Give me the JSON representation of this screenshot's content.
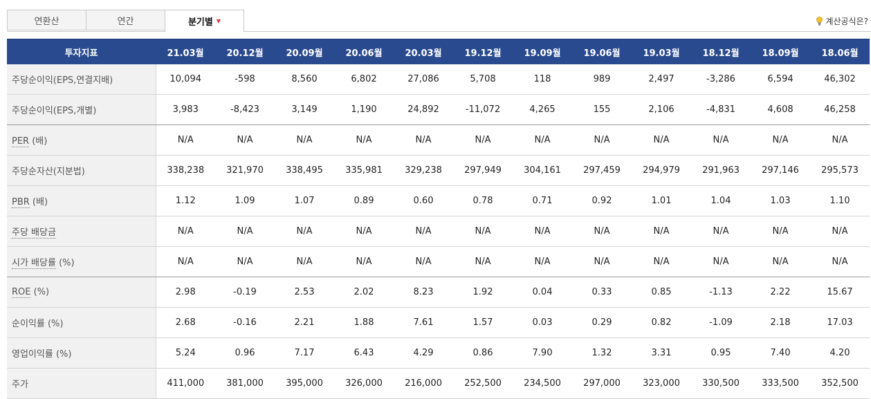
{
  "tabs": [
    {
      "label": "연환산"
    },
    {
      "label": "연간"
    },
    {
      "label": "분기별"
    }
  ],
  "help_link": "계산공식은?",
  "table": {
    "header_label": "투자지표",
    "periods": [
      "21.03월",
      "20.12월",
      "20.09월",
      "20.06월",
      "20.03월",
      "19.12월",
      "19.09월",
      "19.06월",
      "19.03월",
      "18.12월",
      "18.09월",
      "18.06월"
    ],
    "rows": [
      {
        "label": "주당순이익(EPS,연결지배)",
        "values": [
          "10,094",
          "-598",
          "8,560",
          "6,802",
          "27,086",
          "5,708",
          "118",
          "989",
          "2,497",
          "-3,286",
          "6,594",
          "46,302"
        ]
      },
      {
        "label": "주당순이익(EPS,개별)",
        "values": [
          "3,983",
          "-8,423",
          "3,149",
          "1,190",
          "24,892",
          "-11,072",
          "4,265",
          "155",
          "2,106",
          "-4,831",
          "4,608",
          "46,258"
        ]
      },
      {
        "label": "PER",
        "unit": " (배)",
        "values": [
          "N/A",
          "N/A",
          "N/A",
          "N/A",
          "N/A",
          "N/A",
          "N/A",
          "N/A",
          "N/A",
          "N/A",
          "N/A",
          "N/A"
        ]
      },
      {
        "label": "주당순자산(지분법)",
        "values": [
          "338,238",
          "321,970",
          "338,495",
          "335,981",
          "329,238",
          "297,949",
          "304,161",
          "297,459",
          "294,979",
          "291,963",
          "297,146",
          "295,573"
        ]
      },
      {
        "label": "PBR",
        "unit": " (배)",
        "values": [
          "1.12",
          "1.09",
          "1.07",
          "0.89",
          "0.60",
          "0.78",
          "0.71",
          "0.92",
          "1.01",
          "1.04",
          "1.03",
          "1.10"
        ]
      },
      {
        "label": "주당 배당금",
        "values": [
          "N/A",
          "N/A",
          "N/A",
          "N/A",
          "N/A",
          "N/A",
          "N/A",
          "N/A",
          "N/A",
          "N/A",
          "N/A",
          "N/A"
        ]
      },
      {
        "label": "시가 배당률",
        "unit": " (%)",
        "values": [
          "N/A",
          "N/A",
          "N/A",
          "N/A",
          "N/A",
          "N/A",
          "N/A",
          "N/A",
          "N/A",
          "N/A",
          "N/A",
          "N/A"
        ]
      },
      {
        "label": "ROE",
        "unit": " (%)",
        "values": [
          "2.98",
          "-0.19",
          "2.53",
          "2.02",
          "8.23",
          "1.92",
          "0.04",
          "0.33",
          "0.85",
          "-1.13",
          "2.22",
          "15.67"
        ]
      },
      {
        "label": "순이익률",
        "unit": " (%)",
        "values": [
          "2.68",
          "-0.16",
          "2.21",
          "1.88",
          "7.61",
          "1.57",
          "0.03",
          "0.29",
          "0.82",
          "-1.09",
          "2.18",
          "17.03"
        ]
      },
      {
        "label": "영업이익률",
        "unit": " (%)",
        "values": [
          "5.24",
          "0.96",
          "7.17",
          "6.43",
          "4.29",
          "0.86",
          "7.90",
          "1.32",
          "3.31",
          "0.95",
          "7.40",
          "4.20"
        ]
      },
      {
        "label": "주가",
        "values": [
          "411,000",
          "381,000",
          "395,000",
          "326,000",
          "216,000",
          "252,500",
          "234,500",
          "297,000",
          "323,000",
          "330,500",
          "333,500",
          "352,500"
        ]
      }
    ]
  },
  "colors": {
    "header_bg": "#2a4a8f",
    "label_bg": "#f1f1f1",
    "caret": "#e03a2f"
  }
}
